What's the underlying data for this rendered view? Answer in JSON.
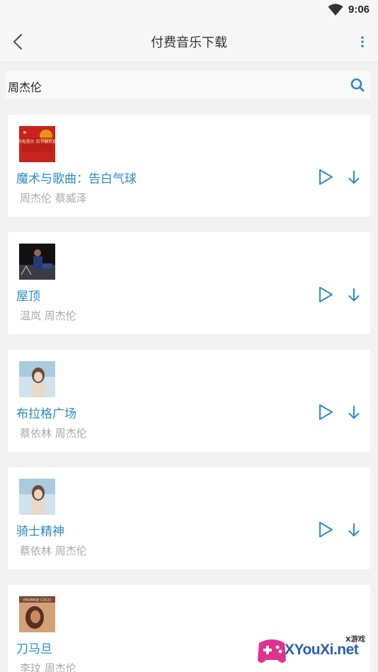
{
  "status_bar": {
    "time": "9:06",
    "wifi_icon": "wifi-icon"
  },
  "header": {
    "title": "付费音乐下载",
    "back_icon": "chevron-left-icon",
    "more_icon": "more-vertical-icon"
  },
  "search": {
    "value": "周杰伦",
    "icon": "search-icon"
  },
  "songs": [
    {
      "title": "魔术与歌曲：告白气球",
      "artist": "周杰伦 蔡威泽",
      "cover_text": "中央电视台 百节联欢晚会"
    },
    {
      "title": "屋顶",
      "artist": "温岚 周杰伦"
    },
    {
      "title": "布拉格广场",
      "artist": "蔡依林 周杰伦"
    },
    {
      "title": "骑士精神",
      "artist": "蔡依林 周杰伦"
    },
    {
      "title": "刀马旦",
      "artist": "李玟 周杰伦",
      "cover_text": "PROMISE COCO"
    }
  ],
  "watermark": {
    "small_text": "X游戏",
    "big_text": "XYouXi.net"
  },
  "colors": {
    "accent": "#2d8cc8",
    "artist": "#aaaaaa",
    "background": "#f2f2f2"
  }
}
